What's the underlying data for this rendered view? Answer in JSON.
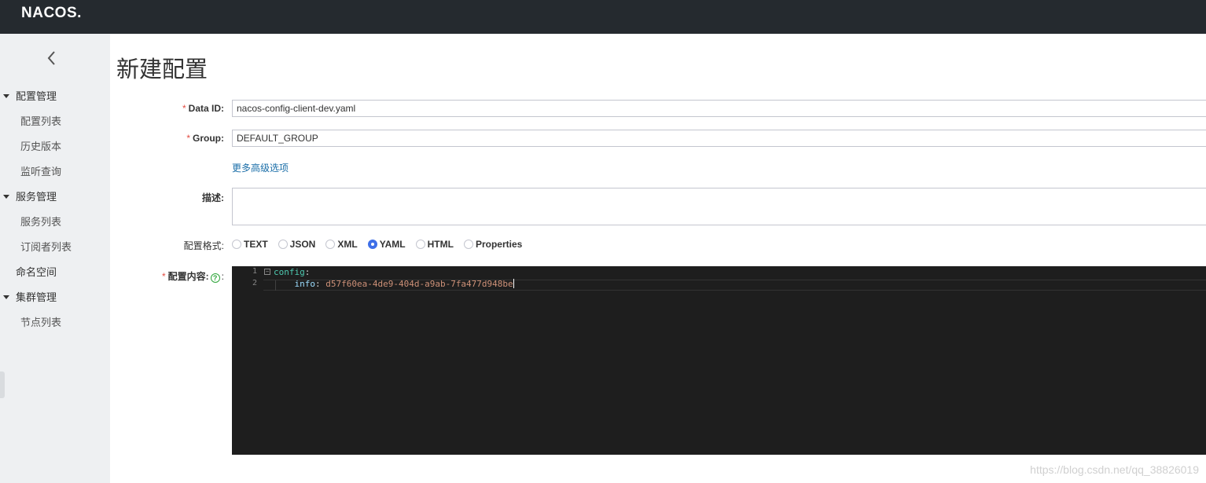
{
  "header": {
    "logo": "NACOS."
  },
  "sidebar": {
    "groups": [
      {
        "label": "配置管理",
        "items": [
          "配置列表",
          "历史版本",
          "监听查询"
        ]
      },
      {
        "label": "服务管理",
        "items": [
          "服务列表",
          "订阅者列表"
        ]
      },
      {
        "label": "命名空间"
      },
      {
        "label": "集群管理",
        "items": [
          "节点列表"
        ]
      }
    ]
  },
  "main": {
    "title": "新建配置",
    "form": {
      "data_id_label": "Data ID:",
      "data_id_value": "nacos-config-client-dev.yaml",
      "group_label": "Group:",
      "group_value": "DEFAULT_GROUP",
      "advanced_link": "更多高级选项",
      "desc_label": "描述:",
      "format_label": "配置格式:",
      "formats": [
        "TEXT",
        "JSON",
        "XML",
        "YAML",
        "HTML",
        "Properties"
      ],
      "selected_format": "YAML",
      "content_label": "配置内容:",
      "required_mark": "*",
      "help_icon": "?",
      "colon": ":"
    },
    "editor": {
      "lines": [
        {
          "number": "1",
          "key": "config",
          "colon": ":",
          "value": ""
        },
        {
          "number": "2",
          "key": "info",
          "colon": ":",
          "value": "d57f60ea-4de9-404d-a9ab-7fa477d948be"
        }
      ]
    }
  },
  "watermark": "https://blog.csdn.net/qq_38826019"
}
